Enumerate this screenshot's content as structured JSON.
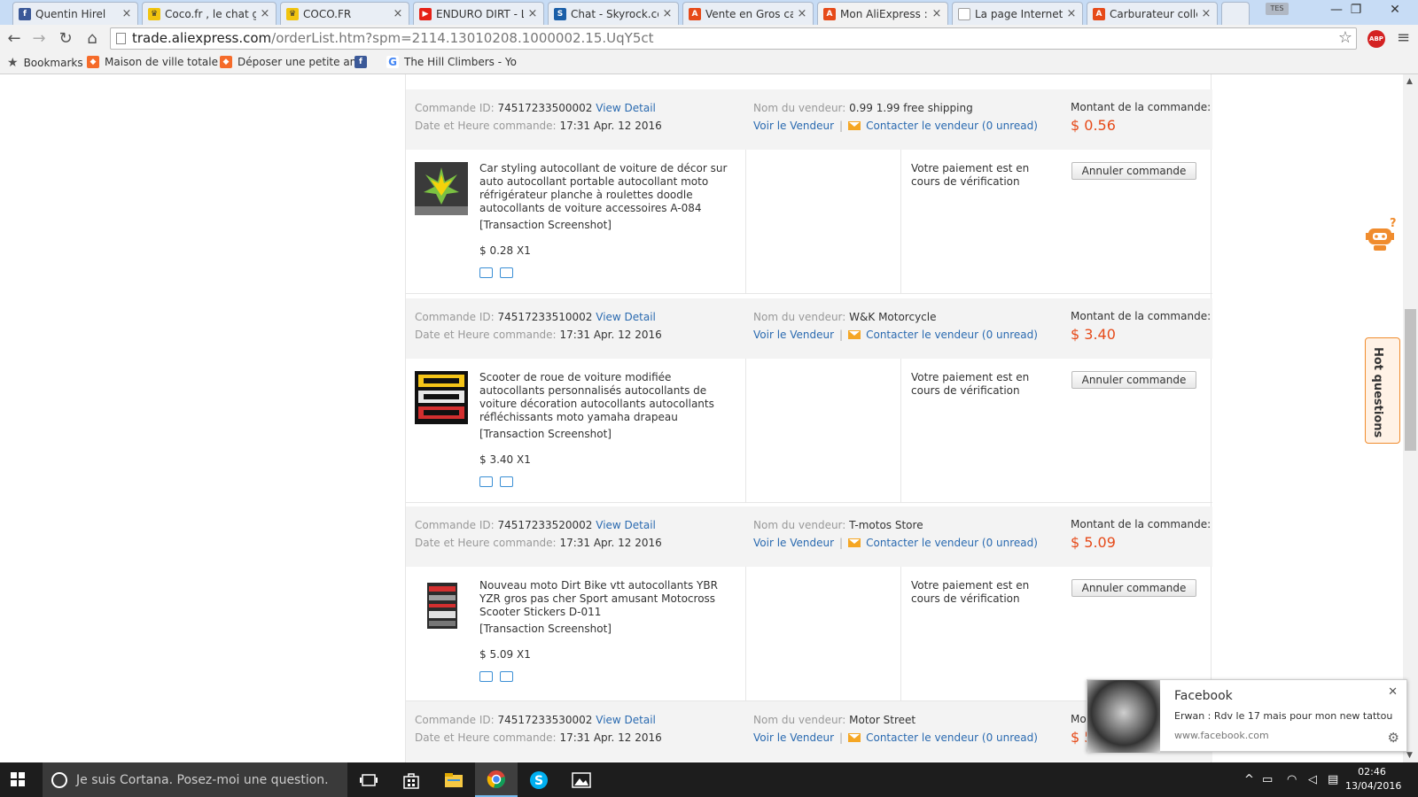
{
  "browser": {
    "tabs": [
      {
        "title": "Quentin Hirel",
        "icon": "facebook-icon",
        "color": "#3b5998",
        "glyph": "f"
      },
      {
        "title": "Coco.fr , le chat gr",
        "icon": "crown-icon",
        "color": "#f1c40f",
        "glyph": "♛"
      },
      {
        "title": "COCO.FR",
        "icon": "crown-icon",
        "color": "#f1c40f",
        "glyph": "♛"
      },
      {
        "title": "ENDURO DIRT - Li",
        "icon": "youtube-icon",
        "color": "#e62117",
        "glyph": "▶"
      },
      {
        "title": "Chat - Skyrock.cor",
        "icon": "skyrock-icon",
        "color": "#1b5fa8",
        "glyph": "S"
      },
      {
        "title": "Vente en Gros car",
        "icon": "aliexpress-icon",
        "color": "#e64a19",
        "glyph": "A"
      },
      {
        "title": "Mon AliExpress : g",
        "icon": "aliexpress-icon",
        "color": "#e64a19",
        "glyph": "A"
      },
      {
        "title": "La page Internet a",
        "icon": "page-icon",
        "color": "#9e9e9e",
        "glyph": ""
      },
      {
        "title": "Carburateur colle",
        "icon": "aliexpress-icon",
        "color": "#e64a19",
        "glyph": "A"
      }
    ],
    "profile_badge": "TES",
    "window_controls": {
      "minimize": "—",
      "maximize": "❐",
      "close": "✕"
    },
    "url_host": "trade.aliexpress.com",
    "url_path": "/orderList.htm?spm=2114.13010208.1000002.15.UqY5ct",
    "abp_label": "ABP",
    "bookmarks": [
      {
        "title": "Bookmarks",
        "icon": "star-icon",
        "color": "#555555",
        "glyph": "★"
      },
      {
        "title": "Maison de ville totale",
        "icon": "leboncoin-icon",
        "color": "#f56b2a",
        "glyph": "◆"
      },
      {
        "title": "Déposer une petite an",
        "icon": "leboncoin-icon",
        "color": "#f56b2a",
        "glyph": "◆"
      },
      {
        "title": "",
        "icon": "facebook-icon",
        "color": "#3b5998",
        "glyph": "f"
      },
      {
        "title": "The Hill Climbers - Yo",
        "icon": "google-icon",
        "color": "#4285f4",
        "glyph": "G"
      }
    ]
  },
  "labels": {
    "order_id": "Commande ID:",
    "order_date": "Date et Heure commande:",
    "seller_name": "Nom du vendeur:",
    "view_seller": "Voir le Vendeur",
    "contact_prefix": "Contacter le vendeur (",
    "contact_suffix": " unread)",
    "amount": "Montant de la commande:",
    "view_detail": "View Detail",
    "transaction": "[Transaction Screenshot]",
    "cancel": "Annuler commande",
    "separator": "|"
  },
  "orders": [
    {
      "id": "74517233500002",
      "date": "17:31 Apr. 12 2016",
      "seller": "0.99 1.99 free shipping",
      "unread": "0",
      "amount": "$ 0.56",
      "product": "Car styling autocollant de voiture de décor sur auto autocollant portable autocollant moto réfrigérateur planche à roulettes doodle autocollants de voiture accessoires A-084",
      "price_qty": "$ 0.28 X1",
      "status": "Votre paiement est en cours de vérification"
    },
    {
      "id": "74517233510002",
      "date": "17:31 Apr. 12 2016",
      "seller": "W&K Motorcycle",
      "unread": "0",
      "amount": "$ 3.40",
      "product": "Scooter de roue de voiture modifiée autocollants personnalisés autocollants de voiture décoration autocollants autocollants réfléchissants moto yamaha drapeau",
      "price_qty": "$ 3.40 X1",
      "status": "Votre paiement est en cours de vérification"
    },
    {
      "id": "74517233520002",
      "date": "17:31 Apr. 12 2016",
      "seller": "T-motos Store",
      "unread": "0",
      "amount": "$ 5.09",
      "product": "Nouveau moto Dirt Bike vtt autocollants YBR YZR gros pas cher Sport amusant Motocross Scooter Stickers D-011",
      "price_qty": "$ 5.09 X1",
      "status": "Votre paiement est en cours de vérification"
    },
    {
      "id": "74517233530002",
      "date": "17:31 Apr. 12 2016",
      "seller": "Motor Street",
      "unread": "0",
      "amount_partial": "Mo",
      "amount_partial_2": "$ 5"
    }
  ],
  "hot_questions": "Hot questions",
  "notification": {
    "title": "Facebook",
    "message": "Erwan : Rdv le 17 mais pour mon new tattou",
    "site": "www.facebook.com"
  },
  "taskbar": {
    "cortana": "Je suis Cortana. Posez-moi une question.",
    "time": "02:46",
    "date": "13/04/2016"
  }
}
